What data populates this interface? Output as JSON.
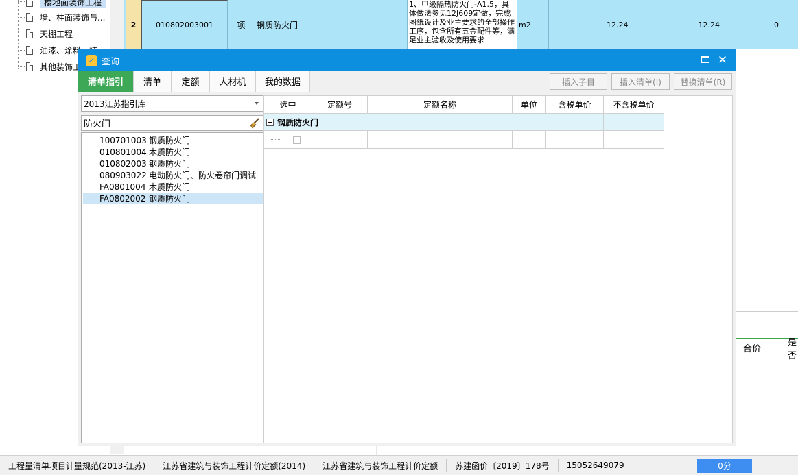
{
  "bg": {
    "tree_items": [
      "楼地面装饰工程",
      "墙、柱面装饰与...",
      "天棚工程",
      "油漆、涂料、裱...",
      "其他装饰工..."
    ],
    "row": {
      "index": "2",
      "code": "010802003001",
      "unit_label": "项",
      "name": "钢质防火门",
      "description": "1、甲级隔热防火门-A1.5，具体做法参见12J609定做，完成图纸设计及业主要求的全部操作工序，包含所有五金配件等，满足业主验收及使用要求",
      "unit": "m2",
      "qty": "12.24",
      "qty2": "12.24",
      "zero": "0"
    },
    "right_headers": [
      "合价",
      "是否"
    ]
  },
  "dialog": {
    "title": "查询",
    "tabs": [
      "清单指引",
      "清单",
      "定额",
      "人材机",
      "我的数据"
    ],
    "buttons": {
      "insert_child": "插入子目",
      "insert_list": "插入清单(I)",
      "replace_list": "替换清单(R)"
    },
    "library": "2013江苏指引库",
    "search_value": "防火门",
    "results": [
      {
        "code": "100701003",
        "name": "钢质防火门"
      },
      {
        "code": "010801004",
        "name": "木质防火门"
      },
      {
        "code": "010802003",
        "name": "钢质防火门"
      },
      {
        "code": "080903022",
        "name": "电动防火门、防火卷帘门调试"
      },
      {
        "code": "FA0801004",
        "name": "木质防火门"
      },
      {
        "code": "FA0802002",
        "name": "钢质防火门"
      }
    ],
    "selected_index": 5,
    "grid": {
      "headers": [
        "选中",
        "定额号",
        "定额名称",
        "单位",
        "含税单价",
        "不含税单价"
      ],
      "group_name": "钢质防火门"
    }
  },
  "status": {
    "segments": [
      "工程量清单项目计量规范(2013-江苏)",
      "江苏省建筑与装饰工程计价定额(2014)",
      "江苏省建筑与装饰工程计价定额",
      "苏建函价〔2019〕178号",
      "15052649079"
    ],
    "score": "0分"
  }
}
